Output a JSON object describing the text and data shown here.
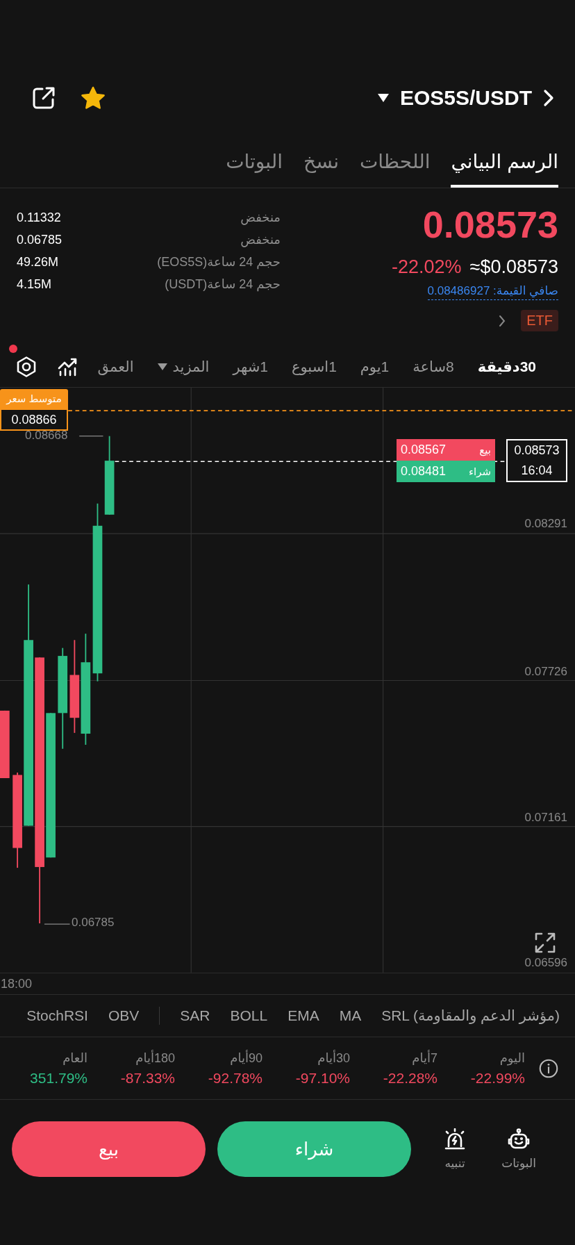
{
  "header": {
    "pair": "EOS5S/USDT",
    "favorite": true
  },
  "tabs": [
    {
      "label": "الرسم البياني",
      "selected": true
    },
    {
      "label": "اللحظات",
      "selected": false
    },
    {
      "label": "نسخ",
      "selected": false
    },
    {
      "label": "البوتات",
      "selected": false
    }
  ],
  "ticker": {
    "price": "0.08573",
    "change": "-22.02%",
    "usd_price": "≈$0.08573",
    "net_value": "صافي القيمة: 0.08486927",
    "badge": "ETF"
  },
  "stats": [
    {
      "label": "منخفض",
      "value": "0.11332"
    },
    {
      "label": "منخفض",
      "value": "0.06785"
    },
    {
      "label": "حجم 24 ساعة(EOS5S)",
      "value": "49.26M"
    },
    {
      "label": "حجم 24 ساعة(USDT)",
      "value": "4.15M"
    }
  ],
  "toolbar": {
    "settings_badge": true
  },
  "timeframes": [
    {
      "label": "30دقيقة",
      "kind": "interval",
      "selected": true
    },
    {
      "label": "8ساعة",
      "kind": "interval",
      "selected": false
    },
    {
      "label": "1يوم",
      "kind": "interval",
      "selected": false
    },
    {
      "label": "1اسبوع",
      "kind": "interval",
      "selected": false
    },
    {
      "label": "1شهر",
      "kind": "interval",
      "selected": false
    },
    {
      "label": "المزيد",
      "kind": "dropdown",
      "selected": false
    },
    {
      "label": "العمق",
      "kind": "interval",
      "selected": false
    }
  ],
  "chart": {
    "avg_price_label": "متوسط سعر",
    "avg_price": "0.08866",
    "high_label": "0.08668",
    "low_label": "0.06785",
    "sell_label": "بيع",
    "sell_price": "0.08567",
    "buy_label": "شراء",
    "buy_price": "0.08481",
    "last_price": "0.08573",
    "countdown": "16:04",
    "y_ticks": [
      "0.08291",
      "0.07726",
      "0.07161",
      "0.06596"
    ],
    "x_label": "18:00"
  },
  "main_indicators": [
    "SRL (مؤشر الدعم والمقاومة)",
    "MA",
    "EMA",
    "BOLL",
    "SAR"
  ],
  "sub_indicators": [
    "OBV",
    "StochRSI"
  ],
  "performance": [
    {
      "period": "اليوم",
      "change": "-22.99%",
      "color": "#f2495f"
    },
    {
      "period": "7أيام",
      "change": "-22.28%",
      "color": "#f2495f"
    },
    {
      "period": "30أيام",
      "change": "-97.10%",
      "color": "#f2495f"
    },
    {
      "period": "90أيام",
      "change": "-92.78%",
      "color": "#f2495f"
    },
    {
      "period": "180أيام",
      "change": "-87.33%",
      "color": "#f2495f"
    },
    {
      "period": "العام",
      "change": "351.79%",
      "color": "#2ebd85"
    }
  ],
  "bottom_bar": {
    "shortcuts": [
      {
        "label": "البوتات",
        "kind": "bot"
      },
      {
        "label": "تنبيه",
        "kind": "alert"
      }
    ],
    "buy": "شراء",
    "sell": "بيع"
  }
}
